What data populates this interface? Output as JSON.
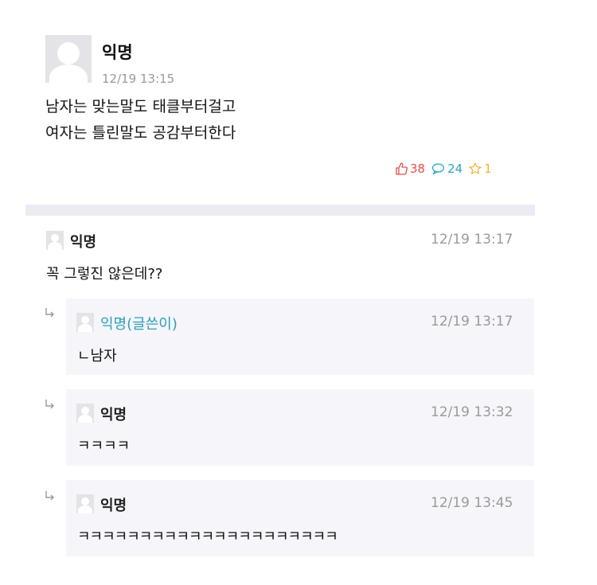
{
  "post": {
    "author": "익명",
    "time": "12/19 13:15",
    "body": "남자는 맞는말도 태클부터걸고\n여자는 틀린말도 공감부터한다",
    "likes": "38",
    "comments": "24",
    "scraps": "1"
  },
  "comments": [
    {
      "author": "익명",
      "time": "12/19 13:17",
      "text": "꼭 그렇진 않은데??"
    }
  ],
  "replies": [
    {
      "author": "익명(글쓴이)",
      "time": "12/19 13:17",
      "text": "ㄴ남자"
    },
    {
      "author": "익명",
      "time": "12/19 13:32",
      "text": "ㅋㅋㅋㅋ"
    },
    {
      "author": "익명",
      "time": "12/19 13:45",
      "text": "ㅋㅋㅋㅋㅋㅋㅋㅋㅋㅋㅋㅋㅋㅋㅋㅋㅋㅋㅋㅋㅋ"
    }
  ],
  "colors": {
    "like": "#e0504a",
    "comment": "#2aa6c5",
    "scrap": "#f2b134",
    "op_name": "#2a9fb9"
  },
  "icons": {
    "like": "thumbs-up-icon",
    "comment": "speech-bubble-icon",
    "scrap": "star-icon",
    "reply": "reply-arrow-icon",
    "avatar": "default-avatar-icon"
  }
}
